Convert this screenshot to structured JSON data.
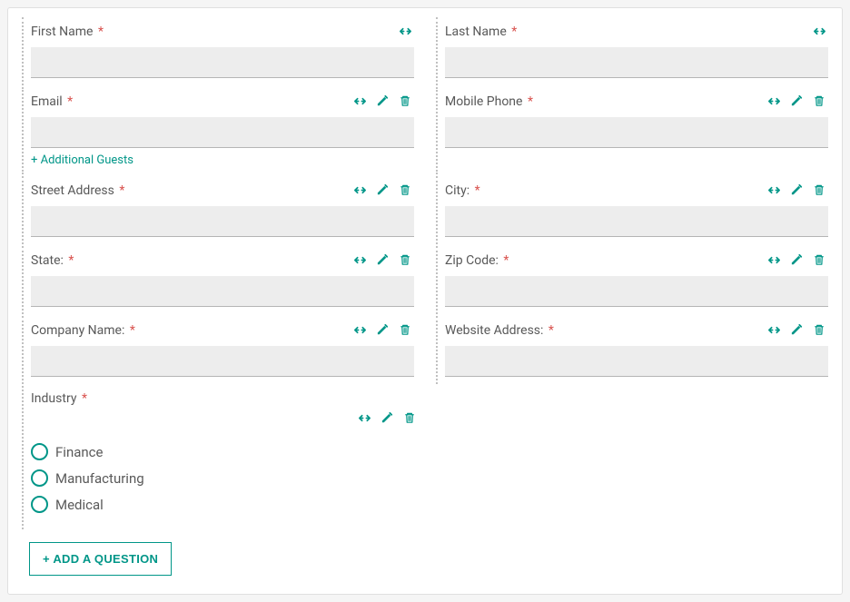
{
  "fields": {
    "first_name": {
      "label": "First Name",
      "required": true
    },
    "last_name": {
      "label": "Last Name",
      "required": true
    },
    "email": {
      "label": "Email",
      "required": true
    },
    "mobile_phone": {
      "label": "Mobile Phone",
      "required": true
    },
    "street_address": {
      "label": "Street Address",
      "required": true
    },
    "city": {
      "label": "City:",
      "required": true
    },
    "state": {
      "label": "State:",
      "required": true
    },
    "zip": {
      "label": "Zip Code:",
      "required": true
    },
    "company": {
      "label": "Company Name:",
      "required": true
    },
    "website": {
      "label": "Website Address:",
      "required": true
    },
    "industry": {
      "label": "Industry",
      "required": true
    }
  },
  "industry_options": [
    "Finance",
    "Manufacturing",
    "Medical"
  ],
  "links": {
    "additional_guests": "+ Additional Guests"
  },
  "buttons": {
    "add_question": "+ ADD A QUESTION"
  },
  "required_marker": "*"
}
